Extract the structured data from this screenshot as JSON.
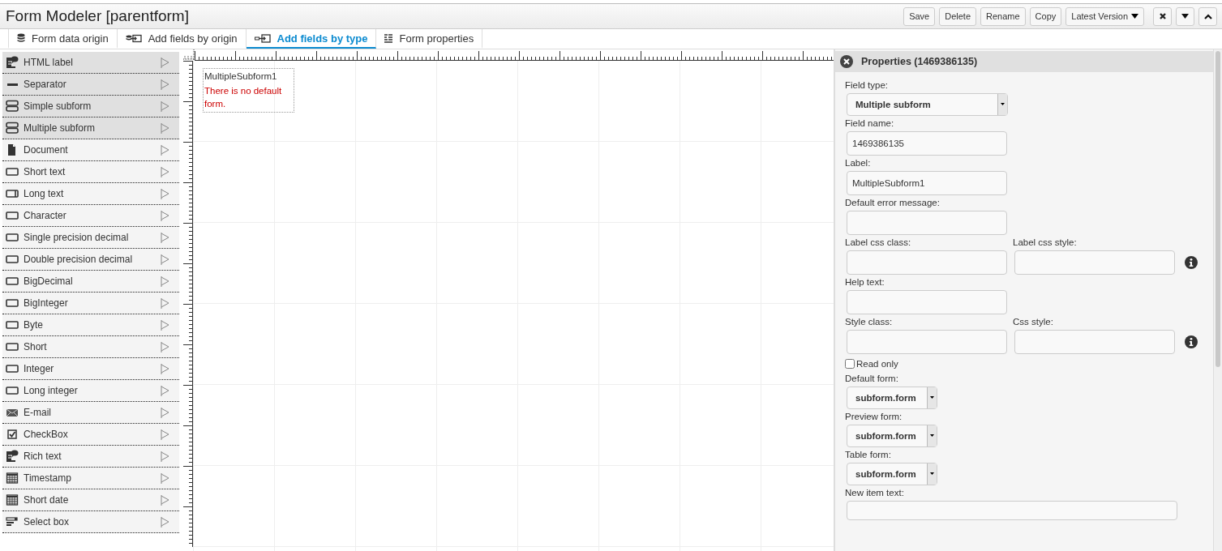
{
  "window": {
    "title": "Form Modeler [parentform]"
  },
  "header_buttons": [
    {
      "kind": "text",
      "label": "Save"
    },
    {
      "kind": "text",
      "label": "Delete"
    },
    {
      "kind": "text",
      "label": "Rename"
    },
    {
      "kind": "text",
      "label": "Copy"
    },
    {
      "kind": "dropdown",
      "label": "Latest Version"
    },
    {
      "kind": "close"
    },
    {
      "kind": "collapse"
    },
    {
      "kind": "expand"
    }
  ],
  "tabs": [
    {
      "label": "Form data origin",
      "kind": "database",
      "selected": false
    },
    {
      "label": "Add fields by origin",
      "kind": "origin",
      "selected": false
    },
    {
      "label": "Add fields by type",
      "kind": "type",
      "selected": true
    },
    {
      "label": "Form properties",
      "kind": "properties",
      "selected": false
    }
  ],
  "palette": [
    {
      "label": "HTML label",
      "kind": "html"
    },
    {
      "label": "Separator",
      "kind": "separator"
    },
    {
      "label": "Simple subform",
      "kind": "subform"
    },
    {
      "label": "Multiple subform",
      "kind": "subform"
    },
    {
      "label": "Document",
      "kind": "document"
    },
    {
      "label": "Short text",
      "kind": "text"
    },
    {
      "label": "Long text",
      "kind": "longtext"
    },
    {
      "label": "Character",
      "kind": "text"
    },
    {
      "label": "Single precision decimal",
      "kind": "text"
    },
    {
      "label": "Double precision decimal",
      "kind": "text"
    },
    {
      "label": "BigDecimal",
      "kind": "text"
    },
    {
      "label": "BigInteger",
      "kind": "text"
    },
    {
      "label": "Byte",
      "kind": "text"
    },
    {
      "label": "Short",
      "kind": "text"
    },
    {
      "label": "Integer",
      "kind": "text"
    },
    {
      "label": "Long integer",
      "kind": "text"
    },
    {
      "label": "E-mail",
      "kind": "email"
    },
    {
      "label": "CheckBox",
      "kind": "checkbox"
    },
    {
      "label": "Rich text",
      "kind": "richtext"
    },
    {
      "label": "Timestamp",
      "kind": "date"
    },
    {
      "label": "Short date",
      "kind": "date"
    },
    {
      "label": "Select box",
      "kind": "select"
    }
  ],
  "canvas": {
    "field": {
      "label": "MultipleSubform1",
      "error": "There is no default form."
    }
  },
  "properties": {
    "title": "Properties (1469386135)",
    "fields": [
      {
        "kind": "type-select",
        "label": "Field type:",
        "value": "Multiple subform"
      },
      {
        "kind": "text",
        "label": "Field name:",
        "value": "1469386135"
      },
      {
        "kind": "text",
        "label": "Label:",
        "value": "MultipleSubform1"
      },
      {
        "kind": "text",
        "label": "Default error message:"
      },
      {
        "kind": "pair",
        "items": [
          {
            "label": "Label css class:"
          },
          {
            "label": "Label css style:"
          }
        ]
      },
      {
        "kind": "text",
        "label": "Help text:"
      },
      {
        "kind": "pair",
        "items": [
          {
            "label": "Style class:"
          },
          {
            "label": "Css style:"
          }
        ]
      },
      {
        "kind": "checkbox",
        "label": "Read only",
        "checked": false
      },
      {
        "kind": "form-select",
        "label": "Default form:",
        "value": "subform.form"
      },
      {
        "kind": "form-select",
        "label": "Preview form:",
        "value": "subform.form"
      },
      {
        "kind": "form-select",
        "label": "Table form:",
        "value": "subform.form"
      },
      {
        "kind": "textarea",
        "label": "New item text:"
      }
    ]
  }
}
